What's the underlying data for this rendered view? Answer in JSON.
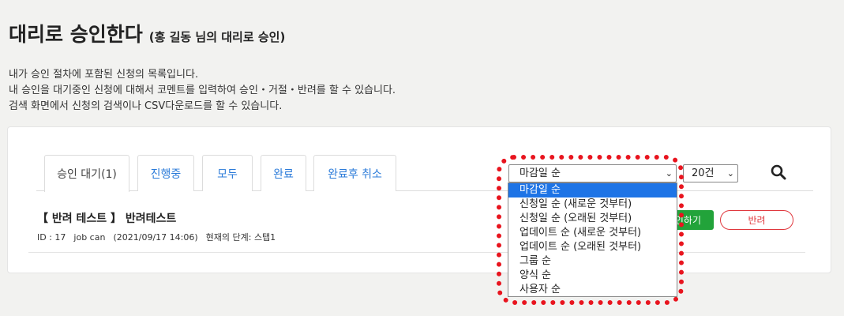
{
  "page": {
    "title": "대리로 승인한다",
    "subtitle": "(홍 길동 님의 대리로 승인)",
    "description": [
      "내가 승인 절차에 포함된 신청의 목록입니다.",
      "내 승인을 대기중인 신청에 대해서 코멘트를 입력하여 승인・거절・반려를 할 수 있습니다.",
      "검색 화면에서 신청의 검색이나 CSV다운로드를 할 수 있습니다."
    ]
  },
  "tabs": [
    {
      "label": "승인 대기(1)",
      "active": true
    },
    {
      "label": "진행중",
      "active": false
    },
    {
      "label": "모두",
      "active": false
    },
    {
      "label": "완료",
      "active": false
    },
    {
      "label": "완료후 취소",
      "active": false
    }
  ],
  "sort": {
    "selected": "마감일 순",
    "options": [
      "마감일 순",
      "신청일 순 (새로운 것부터)",
      "신청일 순 (오래된 것부터)",
      "업데이트 순 (새로운 것부터)",
      "업데이트 순 (오래된 것부터)",
      "그룹 순",
      "양식 순",
      "사용자 순"
    ]
  },
  "page_size": {
    "selected": "20건"
  },
  "search_icon": "search-icon",
  "item": {
    "title": "【 반려 테스트 】 반려테스트",
    "id": "ID : 17",
    "user": "job can",
    "date": "(2021/09/17 14:06)",
    "stage": "현재의 단계: 스탭1",
    "approve_label": "인하기",
    "reject_label": "반려"
  },
  "colors": {
    "accent": "#2b7bd9",
    "approve": "#22a33a",
    "reject": "#e0383e",
    "highlight": "#e8141e",
    "selected_option": "#1e74e6"
  }
}
